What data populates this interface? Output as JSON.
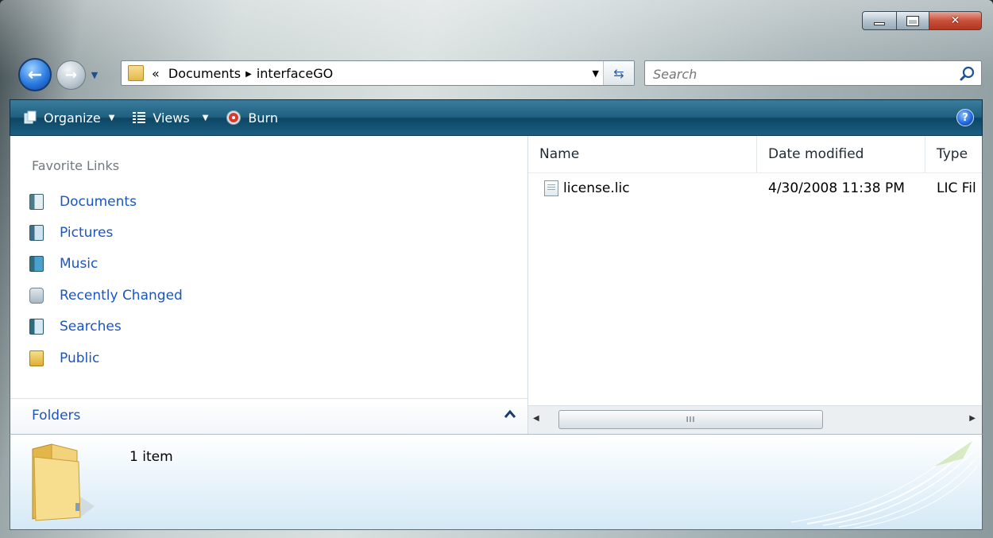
{
  "window": {
    "buttons": {
      "minimize": "minimize",
      "maximize": "maximize",
      "close": "close"
    }
  },
  "address": {
    "path": [
      "«",
      "Documents",
      "interfaceGO"
    ]
  },
  "search": {
    "placeholder": "Search"
  },
  "toolbar": {
    "organize_label": "Organize",
    "views_label": "Views",
    "burn_label": "Burn",
    "help_label": "?"
  },
  "nav": {
    "favorite_title": "Favorite Links",
    "items": [
      {
        "label": "Documents",
        "icon": "documents-icon"
      },
      {
        "label": "Pictures",
        "icon": "pictures-icon"
      },
      {
        "label": "Music",
        "icon": "music-icon"
      },
      {
        "label": "Recently Changed",
        "icon": "recently-changed-icon"
      },
      {
        "label": "Searches",
        "icon": "searches-icon"
      },
      {
        "label": "Public",
        "icon": "public-folder-icon"
      }
    ],
    "folders_label": "Folders"
  },
  "files": {
    "columns": [
      "Name",
      "Date modified",
      "Type"
    ],
    "rows": [
      {
        "name": "license.lic",
        "date_modified": "4/30/2008 11:38 PM",
        "type": "LIC Fil"
      }
    ],
    "scroll_thumb_label": "III"
  },
  "details": {
    "item_count": "1 item"
  },
  "colors": {
    "link_blue": "#1a55c2",
    "toolbar_dark": "#0e4664",
    "close_red": "#c8503a"
  }
}
